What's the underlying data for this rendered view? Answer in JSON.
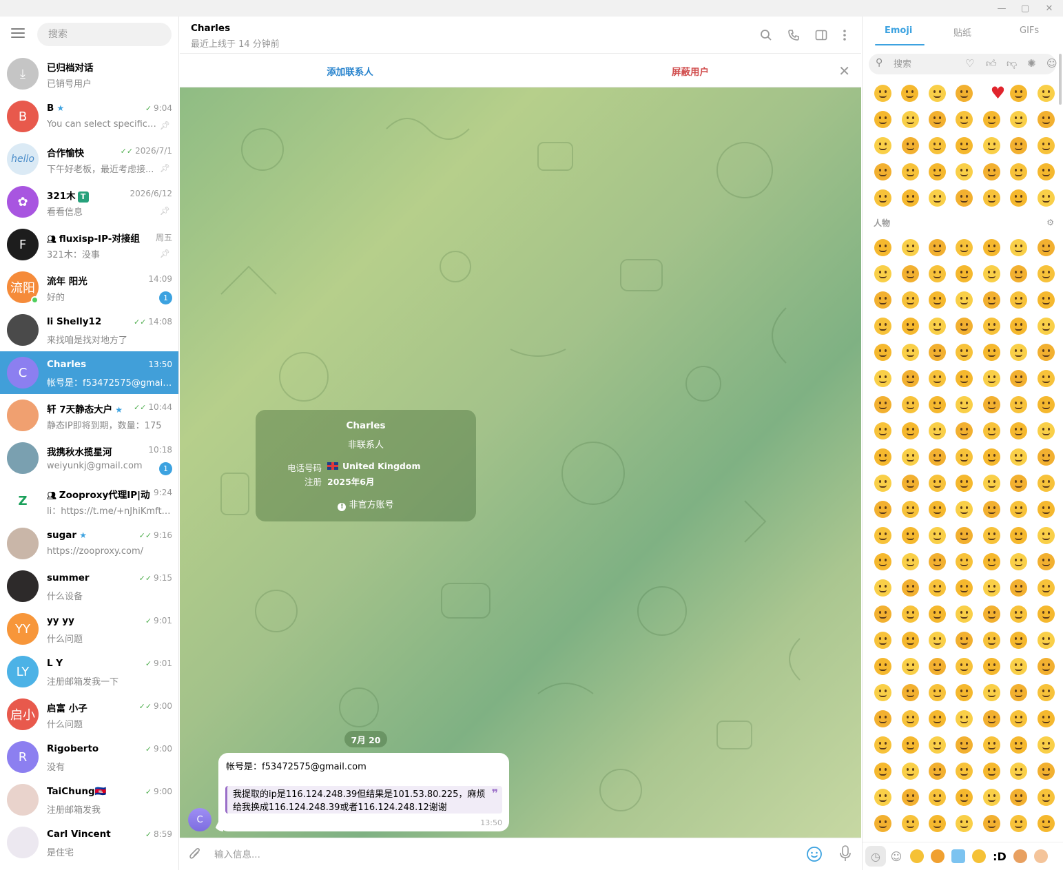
{
  "window": {
    "minimize": "—",
    "maximize": "▢",
    "close": "✕"
  },
  "sidebar": {
    "search_placeholder": "搜索",
    "chats": [
      {
        "name": "已归档对话",
        "preview": "已销号用户",
        "time": "",
        "avatar_text": "⤓",
        "avatar_color": "#c5c5c5",
        "state": "",
        "badge": "",
        "pinned": false
      },
      {
        "name": "B",
        "preview": "You can select specific co...",
        "time": "9:04",
        "avatar_text": "B",
        "avatar_color": "#e8594c",
        "state": "read",
        "badge": "",
        "pinned": true,
        "star": true
      },
      {
        "name": "合作愉快",
        "preview": "下午好老板，最近考虑接...",
        "time": "2026/7/1",
        "avatar_text": "hello",
        "avatar_color": "#dbeaf5",
        "state": "read2",
        "badge": "",
        "pinned": true
      },
      {
        "name": "321木",
        "preview": "看看信息",
        "time": "2026/6/12",
        "avatar_text": "✿",
        "avatar_color": "#a855e0",
        "state": "",
        "badge": "",
        "pinned": true,
        "tag": "T"
      },
      {
        "name": "fluxisp-IP-对接组",
        "preview": "321木：没事",
        "time": "周五",
        "avatar_text": "F",
        "avatar_color": "#1d1d1d",
        "state": "",
        "badge": "",
        "pinned": true,
        "group": true,
        "preview_link": "321木："
      },
      {
        "name": "流年 阳光",
        "preview": "好的",
        "time": "14:09",
        "avatar_text": "流阳",
        "avatar_color": "#f58b3a",
        "state": "",
        "badge": "1",
        "pinned": false,
        "online": true
      },
      {
        "name": "li Shelly12",
        "preview": "来找咱是找对地方了",
        "time": "14:08",
        "avatar_text": "",
        "avatar_color": "#4a4a4a",
        "state": "read2",
        "badge": "",
        "pinned": false
      },
      {
        "name": "Charles",
        "preview": "帐号是：f53472575@gmail.co...",
        "time": "13:50",
        "avatar_text": "C",
        "avatar_color": "#8c7ff0",
        "state": "",
        "badge": "",
        "pinned": false,
        "active": true
      },
      {
        "name": "轩 7天静态大户",
        "preview": "静态IP即将到期，数量：175",
        "time": "10:44",
        "avatar_text": "",
        "avatar_color": "#f0a070",
        "state": "read2",
        "badge": "",
        "pinned": false,
        "star": true
      },
      {
        "name": "我携秋水揽星河",
        "preview": "weiyunkj@gmail.com",
        "time": "10:18",
        "avatar_text": "",
        "avatar_color": "#7aa0b0",
        "state": "",
        "badge": "1",
        "pinned": false
      },
      {
        "name": "Zooproxy代理IP|动...",
        "preview": "li：https://t.me/+nJhiKmft_Jxj...",
        "time": "9:24",
        "avatar_text": "Z",
        "avatar_color": "#ffffff",
        "state": "",
        "badge": "",
        "pinned": false,
        "group": true
      },
      {
        "name": "sugar",
        "preview": "https://zooproxy.com/",
        "time": "9:16",
        "avatar_text": "",
        "avatar_color": "#c9b6a8",
        "state": "read2",
        "badge": "",
        "pinned": false,
        "star": true
      },
      {
        "name": "summer",
        "preview": "什么设备",
        "time": "9:15",
        "avatar_text": "",
        "avatar_color": "#2d2a2a",
        "state": "read2",
        "badge": "",
        "pinned": false
      },
      {
        "name": "yy yy",
        "preview": "什么问题",
        "time": "9:01",
        "avatar_text": "YY",
        "avatar_color": "#f7963a",
        "state": "read",
        "badge": "",
        "pinned": false
      },
      {
        "name": "L Y",
        "preview": "注册邮箱发我一下",
        "time": "9:01",
        "avatar_text": "LY",
        "avatar_color": "#4cb2e6",
        "state": "read",
        "badge": "",
        "pinned": false
      },
      {
        "name": "启富 小子",
        "preview": "什么问题",
        "time": "9:00",
        "avatar_text": "启小",
        "avatar_color": "#e8594c",
        "state": "read2",
        "badge": "",
        "pinned": false
      },
      {
        "name": "Rigoberto",
        "preview": "没有",
        "time": "9:00",
        "avatar_text": "R",
        "avatar_color": "#8c7ff0",
        "state": "read",
        "badge": "",
        "pinned": false
      },
      {
        "name": "TaiChung🇰🇭",
        "preview": "注册邮箱发我",
        "time": "9:00",
        "avatar_text": "",
        "avatar_color": "#e9d3cc",
        "state": "read",
        "badge": "",
        "pinned": false
      },
      {
        "name": "Carl Vincent",
        "preview": "是住宅",
        "time": "8:59",
        "avatar_text": "",
        "avatar_color": "#ece8f0",
        "state": "read",
        "badge": "",
        "pinned": false
      }
    ]
  },
  "chat": {
    "peer_name": "Charles",
    "peer_status": "最近上线于 14 分钟前",
    "add_contact": "添加联系人",
    "block_user": "屏蔽用户",
    "info_card": {
      "name": "Charles",
      "subtitle": "非联系人",
      "phone_label": "电话号码",
      "phone_value": "United Kingdom",
      "reg_label": "注册",
      "reg_value": "2025年6月",
      "unofficial": "非官方账号"
    },
    "date": "7月 20",
    "message": {
      "avatar_text": "C",
      "line1": "帐号是：f53472575@gmail.com",
      "quote": "我提取的ip是116.124.248.39但结果是101.53.80.225，麻烦给我换成116.124.248.39或者116.124.248.12谢谢",
      "time": "13:50"
    },
    "input_placeholder": "输入信息..."
  },
  "emoji_panel": {
    "tabs": [
      "Emoji",
      "贴纸",
      "GIFs"
    ],
    "search_placeholder": "搜索",
    "category_label": "人物",
    "bottom_text_emoji": ":D"
  }
}
